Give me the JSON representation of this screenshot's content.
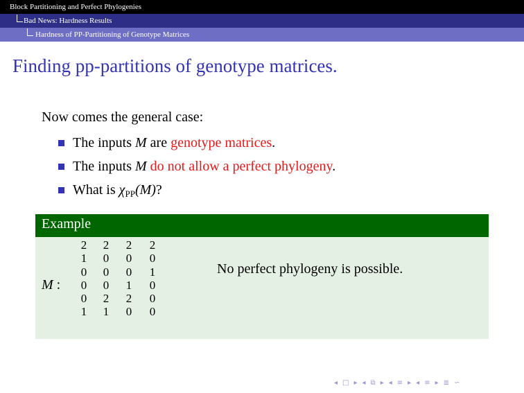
{
  "header": {
    "section": "Block Partitioning and Perfect Phylogenies",
    "subsection": "Bad News: Hardness Results",
    "subsubsection": "Hardness of PP-Partitioning of Genotype Matrices"
  },
  "slide": {
    "title": "Finding pp-partitions of genotype matrices.",
    "intro": "Now comes the general case:",
    "items": [
      {
        "pre": "The inputs ",
        "var": "M",
        "mid": " are ",
        "hl": "genotype matrices",
        "post": "."
      },
      {
        "pre": "The inputs ",
        "var": "M",
        "mid": " ",
        "hl": "do not allow a perfect phylogeny",
        "post": "."
      },
      {
        "pre": "What is ",
        "chi": "χ",
        "sub": "PP",
        "arg": "(M)",
        "post": "?"
      }
    ]
  },
  "example": {
    "heading": "Example",
    "matrix_label": "M",
    "matrix": [
      [
        "2",
        "2",
        "2",
        "2"
      ],
      [
        "1",
        "0",
        "0",
        "0"
      ],
      [
        "0",
        "0",
        "0",
        "1"
      ],
      [
        "0",
        "0",
        "1",
        "0"
      ],
      [
        "0",
        "2",
        "2",
        "0"
      ],
      [
        "1",
        "1",
        "0",
        "0"
      ]
    ],
    "remark": "No perfect phylogeny is possible."
  },
  "colors": {
    "title": "#3333b3",
    "highlight": "#e31a1a",
    "block_header": "#006600",
    "block_body": "#e5f0e5"
  },
  "nav_icons": [
    "frame-prev-icon",
    "frame-next-icon",
    "subsection-prev-icon",
    "subsection-next-icon",
    "section-prev-icon",
    "section-next-icon",
    "align-icon",
    "search-icon"
  ]
}
